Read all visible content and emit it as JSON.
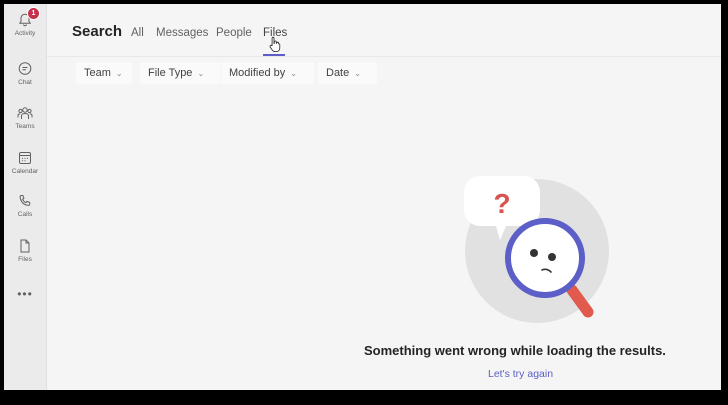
{
  "rail": {
    "activity_label": "Activity",
    "activity_badge": "1",
    "chat_label": "Chat",
    "teams_label": "Teams",
    "calendar_label": "Calendar",
    "calls_label": "Calls",
    "files_label": "Files",
    "more_label": "•••"
  },
  "header": {
    "title": "Search",
    "tabs": [
      {
        "label": "All"
      },
      {
        "label": "Messages"
      },
      {
        "label": "People"
      },
      {
        "label": "Files"
      }
    ],
    "active_tab": "Files"
  },
  "filters": [
    {
      "label": "Team"
    },
    {
      "label": "File Type"
    },
    {
      "label": "Modified by"
    },
    {
      "label": "Date"
    }
  ],
  "empty_state": {
    "question_mark": "?",
    "message": "Something went wrong while loading the results.",
    "retry_label": "Let's try again"
  },
  "colors": {
    "accent": "#5b5fc7",
    "badge": "#c4314b",
    "question": "#d9534f"
  }
}
